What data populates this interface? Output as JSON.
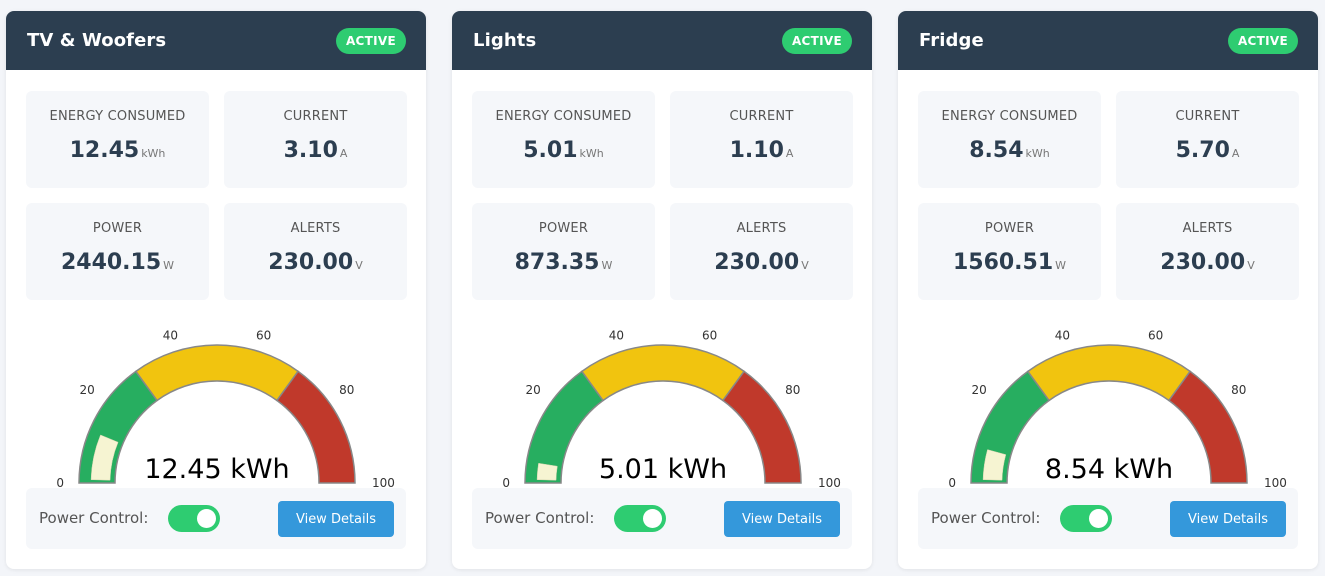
{
  "theme": {
    "header_bg": "#2c3e50",
    "active_green": "#2ecc71",
    "button_blue": "#3498db",
    "gauge_green": "#27ae60",
    "gauge_yellow": "#f1c40f",
    "gauge_red": "#c0392b",
    "needle_fill": "#f6f4d2"
  },
  "labels": {
    "power_control": "Power Control:",
    "view_details": "View Details"
  },
  "devices": [
    {
      "name": "TV & Woofers",
      "status": "ACTIVE",
      "metrics": [
        {
          "label": "ENERGY CONSUMED",
          "value": "12.45",
          "unit": "kWh"
        },
        {
          "label": "CURRENT",
          "value": "3.10",
          "unit": "A"
        },
        {
          "label": "POWER",
          "value": "2440.15",
          "unit": "W"
        },
        {
          "label": "ALERTS",
          "value": "230.00",
          "unit": "V"
        }
      ],
      "gauge": {
        "value": 12.45,
        "min": 0,
        "max": 100,
        "readout": "12.45 kWh",
        "ticks": [
          "0",
          "20",
          "40",
          "60",
          "80",
          "100"
        ]
      },
      "power_on": true
    },
    {
      "name": "Lights",
      "status": "ACTIVE",
      "metrics": [
        {
          "label": "ENERGY CONSUMED",
          "value": "5.01",
          "unit": "kWh"
        },
        {
          "label": "CURRENT",
          "value": "1.10",
          "unit": "A"
        },
        {
          "label": "POWER",
          "value": "873.35",
          "unit": "W"
        },
        {
          "label": "ALERTS",
          "value": "230.00",
          "unit": "V"
        }
      ],
      "gauge": {
        "value": 5.01,
        "min": 0,
        "max": 100,
        "readout": "5.01 kWh",
        "ticks": [
          "0",
          "20",
          "40",
          "60",
          "80",
          "100"
        ]
      },
      "power_on": true
    },
    {
      "name": "Fridge",
      "status": "ACTIVE",
      "metrics": [
        {
          "label": "ENERGY CONSUMED",
          "value": "8.54",
          "unit": "kWh"
        },
        {
          "label": "CURRENT",
          "value": "5.70",
          "unit": "A"
        },
        {
          "label": "POWER",
          "value": "1560.51",
          "unit": "W"
        },
        {
          "label": "ALERTS",
          "value": "230.00",
          "unit": "V"
        }
      ],
      "gauge": {
        "value": 8.54,
        "min": 0,
        "max": 100,
        "readout": "8.54 kWh",
        "ticks": [
          "0",
          "20",
          "40",
          "60",
          "80",
          "100"
        ]
      },
      "power_on": true
    }
  ]
}
